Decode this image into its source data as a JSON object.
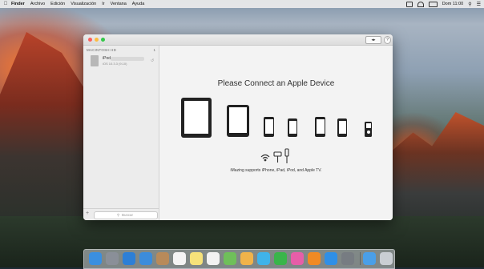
{
  "menubar": {
    "items": [
      "Finder",
      "Archivo",
      "Edición",
      "Visualización",
      "Ir",
      "Ventana",
      "Ayuda"
    ],
    "clock": "Dom 11:00"
  },
  "window": {
    "sidebar": {
      "header": "MACINTOSH HD",
      "count": "1",
      "device": {
        "name": "iPod",
        "subtitle": "iOS 10.3.3 (9.10)"
      },
      "search_placeholder": "Buscar",
      "add_label": "+"
    },
    "toolbar": {
      "toggle_label": "◂▸",
      "help_label": "?"
    },
    "main": {
      "headline": "Please Connect an Apple Device",
      "supported_text": "iMazing supports iPhone, iPad, iPod, and Apple TV."
    }
  },
  "dock": {
    "apps": [
      {
        "name": "Finder",
        "color": "#3a8fe0"
      },
      {
        "name": "Launchpad",
        "color": "#8a8f98"
      },
      {
        "name": "Safari",
        "color": "#2d7fd6"
      },
      {
        "name": "Mail",
        "color": "#3c8cdb"
      },
      {
        "name": "Contacts",
        "color": "#b88a5a"
      },
      {
        "name": "Calendar",
        "color": "#f4f4f4"
      },
      {
        "name": "Notes",
        "color": "#f6e27a"
      },
      {
        "name": "Reminders",
        "color": "#f2f2f2"
      },
      {
        "name": "Maps",
        "color": "#6fbf5a"
      },
      {
        "name": "Photos",
        "color": "#f0b34a"
      },
      {
        "name": "Messages",
        "color": "#3fb3ea"
      },
      {
        "name": "FaceTime",
        "color": "#39b54a"
      },
      {
        "name": "iTunes",
        "color": "#e65ea8"
      },
      {
        "name": "iBooks",
        "color": "#f08a24"
      },
      {
        "name": "App Store",
        "color": "#2f8fe6"
      },
      {
        "name": "System Preferences",
        "color": "#777c82"
      },
      {
        "name": "Downloads",
        "color": "#4a9fe8"
      },
      {
        "name": "Trash",
        "color": "#c9ced3"
      }
    ]
  }
}
